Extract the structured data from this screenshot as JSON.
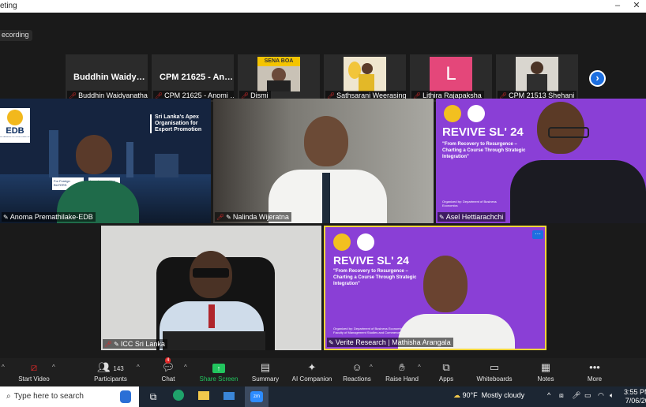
{
  "window": {
    "title": "eting",
    "minimize": "–",
    "close": "✕"
  },
  "recording": {
    "label": "ecording"
  },
  "strip": [
    {
      "name": "Buddhin  Waidy…",
      "label": "Buddhin Waidyanatha"
    },
    {
      "name": "CPM 21625 - An…",
      "label": "CPM 21625 - Anomi …"
    },
    {
      "name": "",
      "label": "Dismi",
      "thumb": "SENA  BOA"
    },
    {
      "name": "",
      "label": "Sathsarani Weerasing…"
    },
    {
      "name": "L",
      "label": "Lithira Rajapaksha"
    },
    {
      "name": "",
      "label": "CPM 21513 Shehani"
    }
  ],
  "next_icon": "›",
  "tiles": [
    {
      "label": "Anoma Premathilake-EDB",
      "slide": {
        "logo": "EDB",
        "logo_sub": "SRI LANKA EXPORT DEVELOPMENT BOARD",
        "headline": "Sri Lanka's Apex Organisation for Export Promotion",
        "card1": "For Foreign BUYERS",
        "card2": "Importers seeking..."
      }
    },
    {
      "label": "Nalinda Wijeratna"
    },
    {
      "label": "Asel Hettiarachchi",
      "slide": {
        "title": "REVIVE SL' 24",
        "tagline": "\"From Recovery to Resurgence – Charting a Course Through Strategic Integration\"",
        "org": "Organized by: Department of Business Economics"
      }
    },
    {
      "label": "ICC Sri Lanka"
    },
    {
      "label": "Verite Research | Mathisha Arangala",
      "slide": {
        "title": "REVIVE SL' 24",
        "tagline": "\"From Recovery to Resurgence – Charting a Course Through Strategic Integration\"",
        "org": "Organized by: Department of Business Economics, Faculty of Management Studies and Commerce"
      }
    }
  ],
  "toolbar": {
    "start_video": "Start Video",
    "participants": "Participants",
    "participants_count": "143",
    "chat": "Chat",
    "chat_badge": "4",
    "share_screen": "Share Screen",
    "summary": "Summary",
    "ai_companion": "AI Companion",
    "reactions": "Reactions",
    "raise_hand": "Raise Hand",
    "apps": "Apps",
    "whiteboards": "Whiteboards",
    "notes": "Notes",
    "more": "More",
    "share_color": "#22c55e"
  },
  "taskbar": {
    "search_placeholder": "Type here to search",
    "weather_temp": "90°F",
    "weather_desc": "Mostly cloudy",
    "time": "3:55 PM",
    "date": "7/06/20"
  },
  "colors": {
    "accent_purple": "#8a3fd6",
    "active_border": "#f2d43a"
  }
}
